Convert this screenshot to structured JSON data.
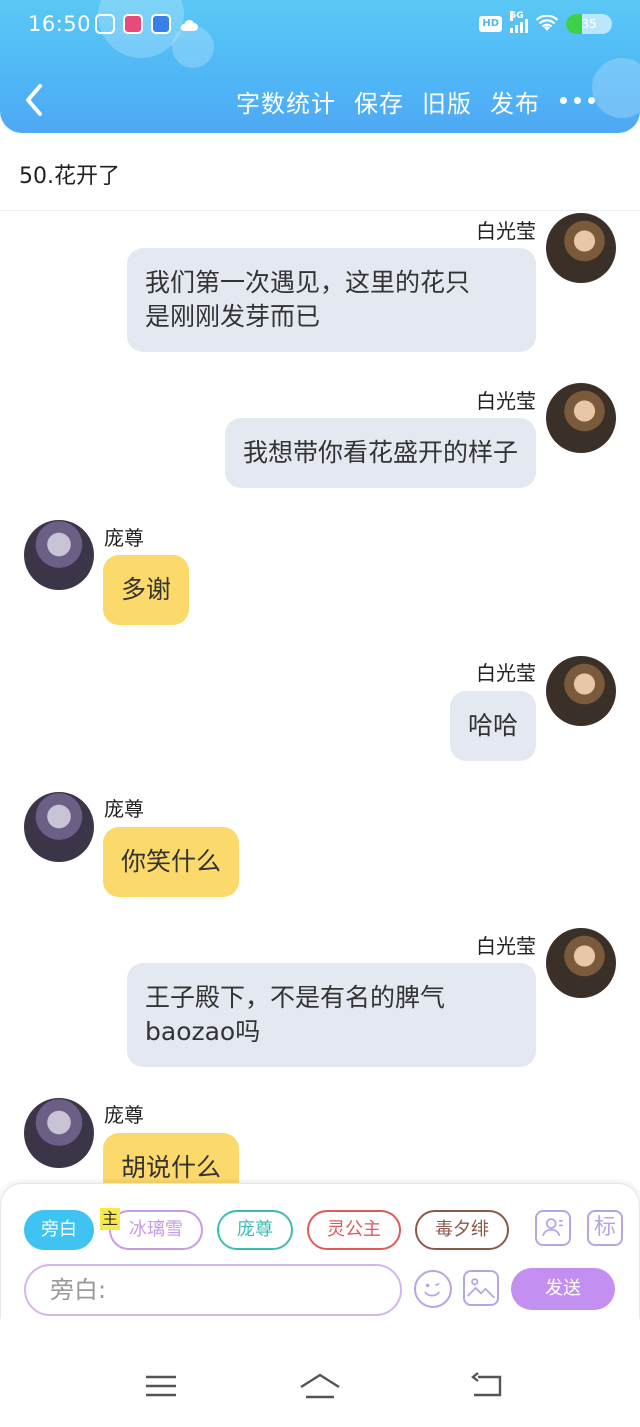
{
  "status_bar": {
    "time": "16:50",
    "network": "5G",
    "hd": "HD",
    "battery": "35",
    "battery_level": 0.35
  },
  "header": {
    "actions": [
      "字数统计",
      "保存",
      "旧版",
      "发布"
    ]
  },
  "chapter": {
    "title": "50.花开了"
  },
  "messages": [
    {
      "side": "right",
      "sender": "白光莹",
      "text_lines": [
        "我们第一次遇见，这里的花只",
        "是刚刚发芽而已"
      ]
    },
    {
      "side": "right",
      "sender": "白光莹",
      "text_lines": [
        "我想带你看花盛开的样子"
      ]
    },
    {
      "side": "left",
      "sender": "庞尊",
      "text_lines": [
        "多谢"
      ]
    },
    {
      "side": "right",
      "sender": "白光莹",
      "text_lines": [
        "哈哈"
      ]
    },
    {
      "side": "left",
      "sender": "庞尊",
      "text_lines": [
        "你笑什么"
      ]
    },
    {
      "side": "right",
      "sender": "白光莹",
      "text_lines": [
        "王子殿下，不是有名的脾气",
        "baozao吗"
      ]
    },
    {
      "side": "left",
      "sender": "庞尊",
      "text_lines": [
        "胡说什么"
      ]
    }
  ],
  "composer": {
    "roles": [
      {
        "label": "旁白",
        "color": "#3ec3f2",
        "active": true
      },
      {
        "label": "冰璃雪",
        "color": "#c79be8",
        "active": false
      },
      {
        "label": "庞尊",
        "color": "#3cbcb4",
        "active": false
      },
      {
        "label": "灵公主",
        "color": "#e05a5a",
        "active": false
      },
      {
        "label": "毒夕绯",
        "color": "#8a5a4a",
        "active": false
      }
    ],
    "main_tag": "主",
    "tag_button_label": "标",
    "input_placeholder": "旁白:",
    "send_label": "发送"
  },
  "colors": {
    "header_gradient_top": "#5ac8f5",
    "right_bubble": "#e4e9f1",
    "left_bubble": "#fcd96b",
    "send_button": "#c38ff0",
    "accent_border": "#d4b6ec"
  }
}
